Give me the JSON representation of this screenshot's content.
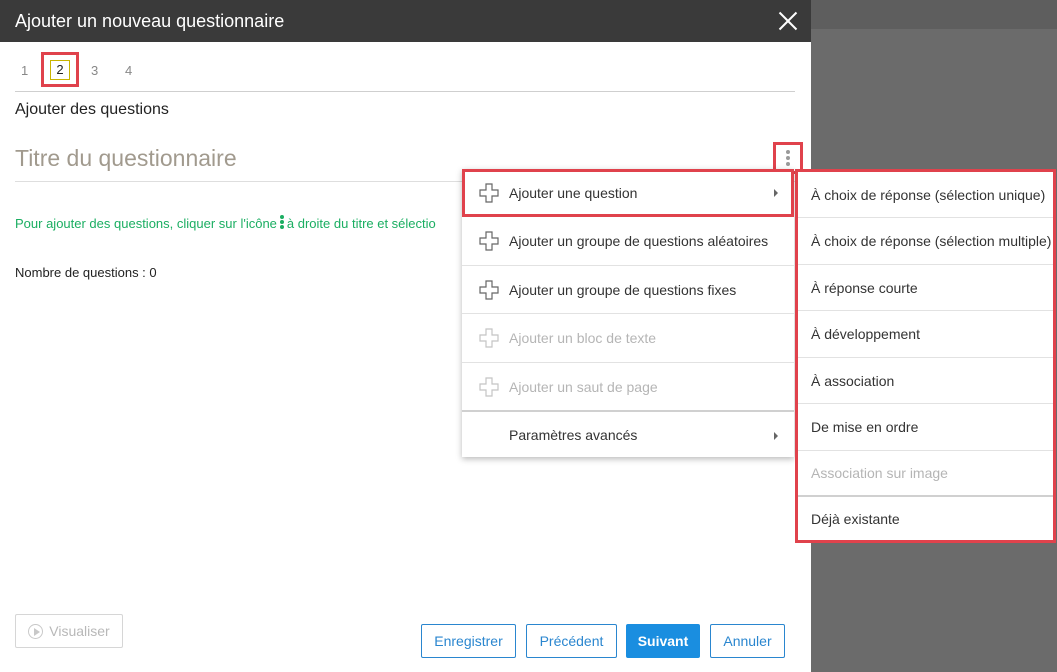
{
  "dialog": {
    "title": "Ajouter un nouveau questionnaire"
  },
  "steps": [
    "1",
    "2",
    "3",
    "4"
  ],
  "active_step": "2",
  "section_heading": "Ajouter des questions",
  "quiz_title_placeholder": "Titre du questionnaire",
  "hint": {
    "before_icon": "Pour ajouter des questions, cliquer sur l'icône",
    "after_icon": "à droite du titre et sélectio"
  },
  "question_count": {
    "label": "Nombre de questions :",
    "value": "0"
  },
  "buttons": {
    "preview": "Visualiser",
    "save": "Enregistrer",
    "previous": "Précédent",
    "next": "Suivant",
    "cancel": "Annuler"
  },
  "menu": {
    "items": [
      {
        "label": "Ajouter une question",
        "icon": "plus-icon",
        "submenu": true,
        "disabled": false
      },
      {
        "label": "Ajouter un groupe de questions aléatoires",
        "icon": "plus-icon",
        "submenu": false,
        "disabled": false
      },
      {
        "label": "Ajouter un groupe de questions fixes",
        "icon": "plus-icon",
        "submenu": false,
        "disabled": false
      },
      {
        "label": "Ajouter un bloc de texte",
        "icon": "plus-icon",
        "submenu": false,
        "disabled": true
      },
      {
        "label": "Ajouter un saut de page",
        "icon": "plus-icon",
        "submenu": false,
        "disabled": true
      },
      {
        "label": "Paramètres avancés",
        "icon": "",
        "submenu": true,
        "disabled": false
      }
    ]
  },
  "submenu": {
    "items": [
      {
        "label": "À choix de réponse (sélection unique)",
        "disabled": false
      },
      {
        "label": "À choix de réponse (sélection multiple)",
        "disabled": false
      },
      {
        "label": "À réponse courte",
        "disabled": false
      },
      {
        "label": "À développement",
        "disabled": false
      },
      {
        "label": "À association",
        "disabled": false
      },
      {
        "label": "De mise en ordre",
        "disabled": false
      },
      {
        "label": "Association sur image",
        "disabled": true
      },
      {
        "label": "Déjà existante",
        "disabled": false
      }
    ]
  },
  "colors": {
    "header_bg": "#3a3a3a",
    "highlight_border": "#e0424c",
    "hint_text": "#1bae62",
    "primary": "#1a8ee0",
    "overlay": "#6b6b6b"
  }
}
